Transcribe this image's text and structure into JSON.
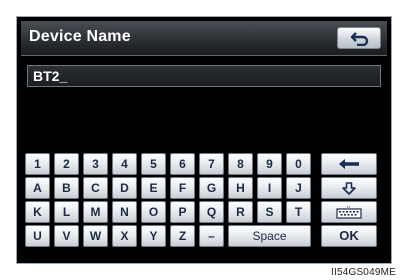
{
  "header": {
    "title": "Device Name",
    "back_icon": "return-arrow-icon"
  },
  "input": {
    "value": "BT2_"
  },
  "keyboard": {
    "row1": [
      "1",
      "2",
      "3",
      "4",
      "5",
      "6",
      "7",
      "8",
      "9",
      "0"
    ],
    "row1_action_icon": "backspace-arrow-icon",
    "row2": [
      "A",
      "B",
      "C",
      "D",
      "E",
      "F",
      "G",
      "H",
      "I",
      "J"
    ],
    "row2_action_icon": "down-arrow-icon",
    "row3": [
      "K",
      "L",
      "M",
      "N",
      "O",
      "P",
      "Q",
      "R",
      "S",
      "T"
    ],
    "row3_action_icon": "keyboard-layout-icon",
    "row4": [
      "U",
      "V",
      "W",
      "X",
      "Y",
      "Z",
      "–"
    ],
    "space_label": "Space",
    "ok_label": "OK"
  },
  "caption": "II54GS049ME"
}
